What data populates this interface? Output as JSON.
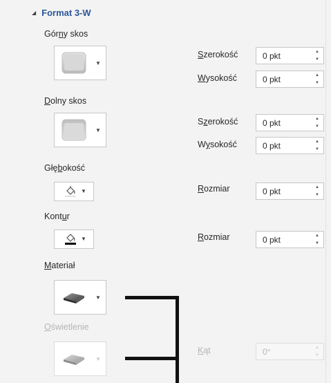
{
  "section": {
    "title": "Format 3-W"
  },
  "top_bevel": {
    "label_pre": "Gór",
    "label_key": "n",
    "label_post": "y skos",
    "width_pre": "",
    "width_key": "S",
    "width_post": "zerokość",
    "width_value": "0 pkt",
    "height_pre": "",
    "height_key": "W",
    "height_post": "ysokość",
    "height_value": "0 pkt"
  },
  "bottom_bevel": {
    "label_pre": "",
    "label_key": "D",
    "label_post": "olny skos",
    "width_pre": "S",
    "width_key": "z",
    "width_post": "erokość",
    "width_value": "0 pkt",
    "height_pre": "W",
    "height_key": "y",
    "height_post": "sokość",
    "height_value": "0 pkt"
  },
  "depth": {
    "label_pre": "Głę",
    "label_key": "b",
    "label_post": "okość",
    "size_pre": "",
    "size_key": "R",
    "size_post": "ozmiar",
    "size_value": "0 pkt"
  },
  "contour": {
    "label_pre": "Kont",
    "label_key": "u",
    "label_post": "r",
    "size_pre": "",
    "size_key": "R",
    "size_post": "ozmiar",
    "size_value": "0 pkt"
  },
  "material": {
    "label_pre": "",
    "label_key": "M",
    "label_post": "ateriał"
  },
  "lighting": {
    "label_pre": "",
    "label_key": "O",
    "label_post": "świetlenie",
    "angle_pre": "",
    "angle_key": "K",
    "angle_post": "ąt",
    "angle_value": "0°"
  },
  "colors": {
    "header": "#2b579a",
    "panel_bg": "#f3f3f3",
    "bracket": "#111111",
    "disabled_text": "#b5b5b5"
  },
  "icons": {
    "collapse": "triangle-down-icon",
    "dropdown": "chevron-down-icon",
    "paint_bucket": "paint-bucket-icon",
    "spinner_up": "spinner-up-icon",
    "spinner_down": "spinner-down-icon"
  }
}
